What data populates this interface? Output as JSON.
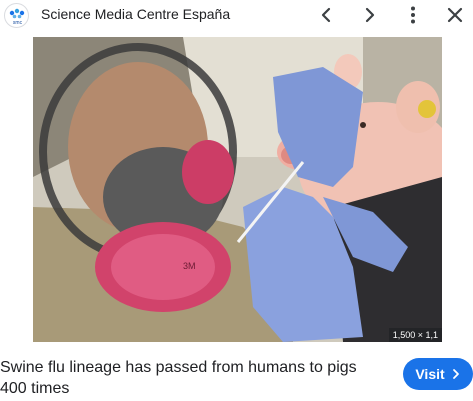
{
  "header": {
    "favicon_icon": "smc-logo-icon",
    "favicon_text": "smc",
    "site_name": "Science Media Centre España",
    "prev_icon": "chevron-left-icon",
    "next_icon": "chevron-right-icon",
    "more_icon": "more-vert-icon",
    "close_icon": "close-icon"
  },
  "image": {
    "dimensions_label": "1,500 × 1,1"
  },
  "caption": {
    "title": "Swine flu lineage has passed from humans to pigs 400 times"
  },
  "visit_button": {
    "label": "Visit",
    "icon": "chevron-right-icon",
    "color": "#1a73e8"
  }
}
